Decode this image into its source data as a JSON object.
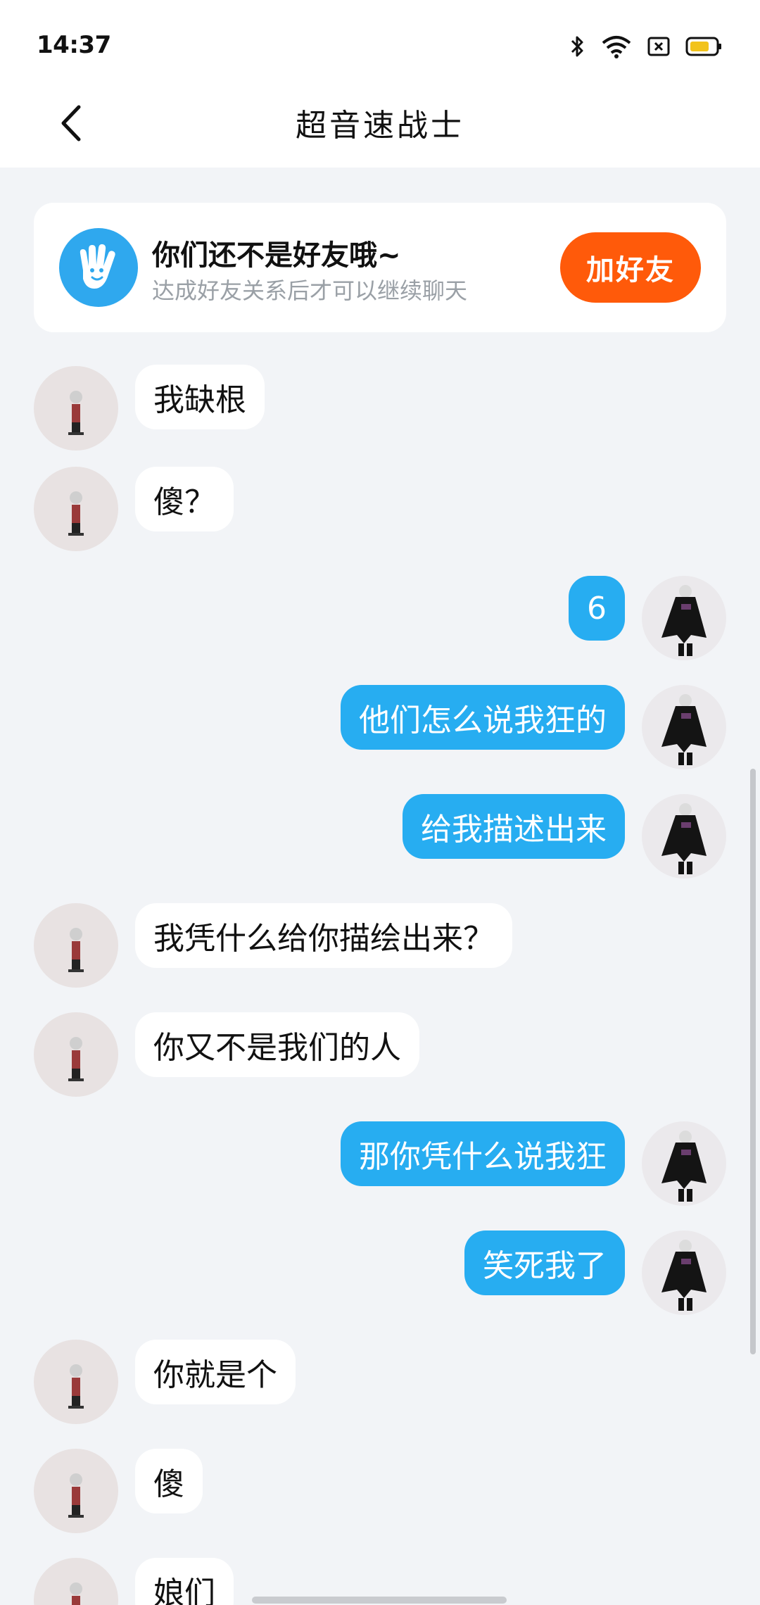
{
  "status_bar": {
    "time": "14:37",
    "icons": [
      "bluetooth-icon",
      "wifi-icon",
      "sim-icon",
      "battery-icon"
    ],
    "battery_color": "#f2c31b"
  },
  "header": {
    "back_icon": "chevron-left-icon",
    "title": "超音速战士"
  },
  "friend_banner": {
    "icon": "waving-hand-icon",
    "title": "你们还不是好友哦~",
    "subtitle": "达成好友关系后才可以继续聊天",
    "add_button": "加好友",
    "button_color": "#ff5a0a"
  },
  "messages": [
    {
      "side": "left",
      "text": "我缺根"
    },
    {
      "side": "left",
      "text": "傻？"
    },
    {
      "side": "right",
      "text": "6"
    },
    {
      "side": "right",
      "text": "他们怎么说我狂的"
    },
    {
      "side": "right",
      "text": "给我描述出来"
    },
    {
      "side": "left",
      "text": "我凭什么给你描绘出来？"
    },
    {
      "side": "left",
      "text": "你又不是我们的人"
    },
    {
      "side": "right",
      "text": "那你凭什么说我狂"
    },
    {
      "side": "right",
      "text": "笑死我了"
    },
    {
      "side": "left",
      "text": "你就是个"
    },
    {
      "side": "left",
      "text": "傻"
    },
    {
      "side": "left",
      "text": "娘们"
    }
  ],
  "colors": {
    "outgoing_bubble": "#27adf1",
    "incoming_bubble": "#ffffff",
    "background": "#f2f4f7"
  }
}
